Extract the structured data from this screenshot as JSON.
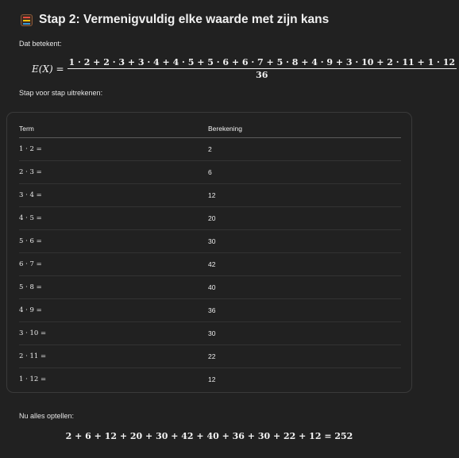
{
  "heading": {
    "icon": "abacus-icon",
    "title": "Stap 2: Vermenigvuldig elke waarde met zijn kans"
  },
  "intro_label": "Dat betekent:",
  "expected_value": {
    "lhs": "E(X) =",
    "numerator": "1 · 2 + 2 · 3 + 3 · 4 + 4 · 5 + 5 · 6 + 6 · 7 + 5 · 8 + 4 · 9 + 3 · 10 + 2 · 11 + 1 · 12",
    "denominator": "36"
  },
  "step_label": "Stap voor stap uitrekenen:",
  "table": {
    "headers": [
      "Term",
      "Berekening"
    ],
    "rows": [
      {
        "term": "1 · 2 =",
        "result": "2"
      },
      {
        "term": "2 · 3 =",
        "result": "6"
      },
      {
        "term": "3 · 4 =",
        "result": "12"
      },
      {
        "term": "4 · 5 =",
        "result": "20"
      },
      {
        "term": "5 · 6 =",
        "result": "30"
      },
      {
        "term": "6 · 7 =",
        "result": "42"
      },
      {
        "term": "5 · 8 =",
        "result": "40"
      },
      {
        "term": "4 · 9 =",
        "result": "36"
      },
      {
        "term": "3 · 10 =",
        "result": "30"
      },
      {
        "term": "2 · 11 =",
        "result": "22"
      },
      {
        "term": "1 · 12 =",
        "result": "12"
      }
    ]
  },
  "sum_label": "Nu alles optellen:",
  "sum_formula": "2 + 6 + 12 + 20 + 30 + 42 + 40 + 36 + 30 + 22 + 12 = 252"
}
